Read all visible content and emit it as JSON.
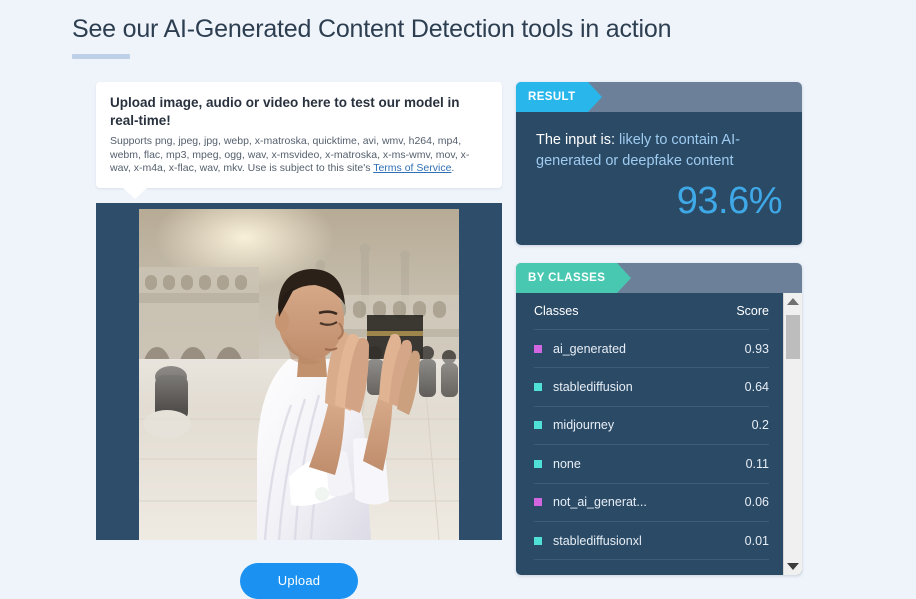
{
  "page": {
    "title": "See our AI-Generated Content Detection tools in action",
    "background_color": "#eff4fb",
    "accent_color": "#bdd0e8"
  },
  "upload_card": {
    "headline": "Upload image, audio or video here to test our model in real-time!",
    "supports_text": "Supports png, jpeg, jpg, webp, x-matroska, quicktime, avi, wmv, h264, mp4, webm, flac, mp3, mpeg, ogg, wav, x-msvideo, x-matroska, x-ms-wmv, mov, x-wav, x-m4a, x-flac, wav, mkv. Use is subject to this site's ",
    "tos_link": "Terms of Service",
    "supports_text_end": "."
  },
  "preview": {
    "alt": "AI-generated photo of a man in white ihram garments praying with raised hands in front of the Kaaba at the Grand Mosque"
  },
  "upload_button": {
    "label": "Upload",
    "color": "#1b92f2"
  },
  "result_panel": {
    "tag": "RESULT",
    "tag_color": "#29b6ea",
    "prefix_label": "The input is:",
    "verdict": "likely to contain AI-generated or deepfake content",
    "percent": "93.6%"
  },
  "classes_panel": {
    "tag": "BY CLASSES",
    "tag_color": "#49c8b1",
    "columns": {
      "name": "Classes",
      "score": "Score"
    },
    "rows": [
      {
        "name": "ai_generated",
        "score": "0.93",
        "color": "#d166e0"
      },
      {
        "name": "stablediffusion",
        "score": "0.64",
        "color": "#4fe0d8"
      },
      {
        "name": "midjourney",
        "score": "0.2",
        "color": "#4fe0d8"
      },
      {
        "name": "none",
        "score": "0.11",
        "color": "#4fe0d8"
      },
      {
        "name": "not_ai_generat...",
        "score": "0.06",
        "color": "#d166e0"
      },
      {
        "name": "stablediffusionxl",
        "score": "0.01",
        "color": "#4fe0d8"
      }
    ],
    "scrollbar": {
      "up_arrow": "scroll-up-arrow",
      "down_arrow": "scroll-down-arrow"
    }
  },
  "chart_data": {
    "type": "bar",
    "title": "By Classes",
    "categories": [
      "ai_generated",
      "stablediffusion",
      "midjourney",
      "none",
      "not_ai_generat...",
      "stablediffusionxl"
    ],
    "values": [
      0.93,
      0.64,
      0.2,
      0.11,
      0.06,
      0.01
    ],
    "xlabel": "Classes",
    "ylabel": "Score",
    "ylim": [
      0,
      1
    ]
  }
}
